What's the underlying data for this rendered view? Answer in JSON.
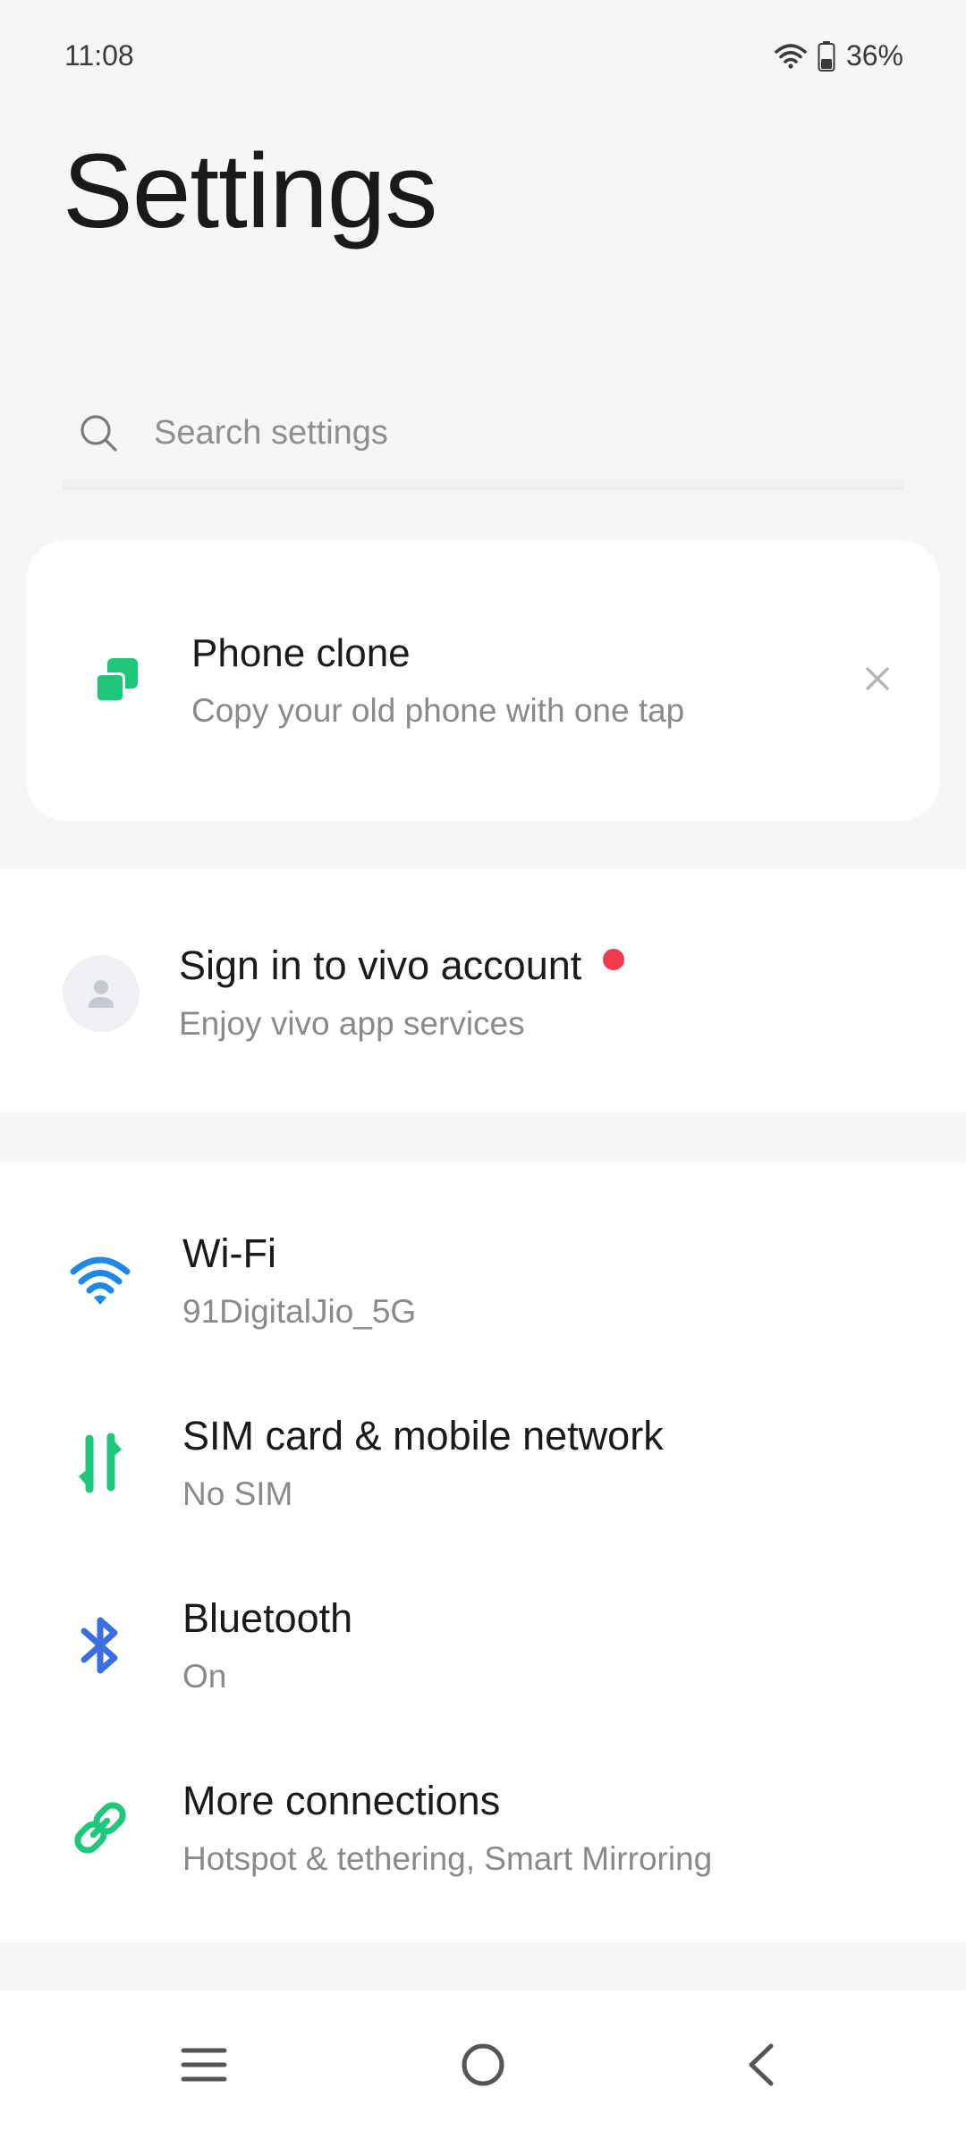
{
  "status_bar": {
    "time": "11:08",
    "battery": "36%",
    "icons": [
      "wifi-icon",
      "battery-icon"
    ]
  },
  "page": {
    "title": "Settings"
  },
  "search": {
    "placeholder": "Search settings"
  },
  "phone_clone": {
    "title": "Phone clone",
    "subtitle": "Copy your old phone with one tap",
    "icon": "phone-clone-icon",
    "accent": "#1ec77a"
  },
  "account": {
    "title": "Sign in to vivo account",
    "subtitle": "Enjoy vivo app services",
    "badge_color": "#f23c4b"
  },
  "connections": {
    "items": [
      {
        "title": "Wi-Fi",
        "subtitle": "91DigitalJio_5G",
        "icon": "wifi-icon",
        "color": "#1e88e5"
      },
      {
        "title": "SIM card & mobile network",
        "subtitle": "No SIM",
        "icon": "sim-network-icon",
        "color": "#1ec77a"
      },
      {
        "title": "Bluetooth",
        "subtitle": "On",
        "icon": "bluetooth-icon",
        "color": "#3b6fe0"
      },
      {
        "title": "More connections",
        "subtitle": "Hotspot & tethering, Smart Mirroring",
        "icon": "link-icon",
        "color": "#1ec77a"
      }
    ]
  },
  "nav_bar": {
    "buttons": [
      "menu-icon",
      "home-icon",
      "back-icon"
    ]
  }
}
